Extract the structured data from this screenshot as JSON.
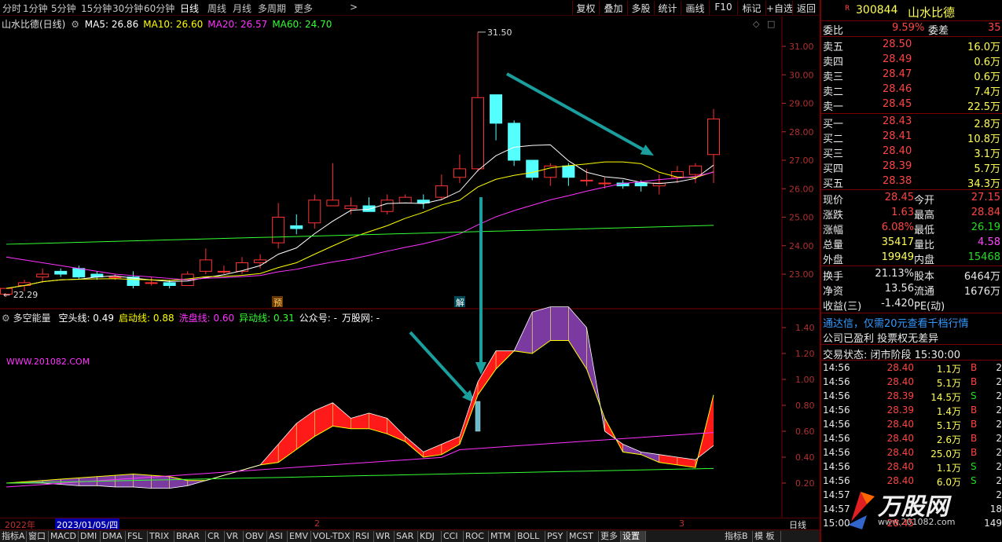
{
  "toolbar": {
    "periods": [
      "分时",
      "1分钟",
      "5分钟",
      "15分钟",
      "30分钟",
      "60分钟",
      "日线",
      "周线",
      "月线",
      "多周期",
      "更多"
    ],
    "active_period": "日线",
    "buttons": [
      "复权",
      "叠加",
      "多股",
      "统计",
      "画线",
      "F10",
      "标记",
      "+自选",
      "返回"
    ]
  },
  "main_chart": {
    "stock_label": "山水比德(日线)",
    "ma_legend": [
      {
        "label": "MA5: 26.86",
        "color": "#ffffff"
      },
      {
        "label": "MA10: 26.60",
        "color": "#ffff00"
      },
      {
        "label": "MA20: 26.57",
        "color": "#ff33ff"
      },
      {
        "label": "MA60: 24.70",
        "color": "#33ff33"
      }
    ],
    "high_label": "31.50",
    "low_label": "22.29",
    "y_ticks": [
      "31.00",
      "30.00",
      "29.00",
      "28.00",
      "27.00",
      "26.00",
      "25.00",
      "24.00",
      "23.00"
    ],
    "markers": [
      "预",
      "解"
    ]
  },
  "candles": [
    [
      22.3,
      22.5,
      22.2,
      22.5
    ],
    [
      22.6,
      22.8,
      22.4,
      22.7
    ],
    [
      22.9,
      23.2,
      22.7,
      23.0
    ],
    [
      23.1,
      23.2,
      22.9,
      23.0
    ],
    [
      23.2,
      23.3,
      22.8,
      22.9
    ],
    [
      23.0,
      23.1,
      22.8,
      22.9
    ],
    [
      22.9,
      23.0,
      22.8,
      22.9
    ],
    [
      22.9,
      23.1,
      22.5,
      22.6
    ],
    [
      22.7,
      22.9,
      22.6,
      22.7
    ],
    [
      22.7,
      22.8,
      22.5,
      22.6
    ],
    [
      22.6,
      23.1,
      22.6,
      23.0
    ],
    [
      23.1,
      23.9,
      23.0,
      23.5
    ],
    [
      23.1,
      23.3,
      23.0,
      23.1
    ],
    [
      23.1,
      23.6,
      23.0,
      23.4
    ],
    [
      23.4,
      23.7,
      23.2,
      23.5
    ],
    [
      24.1,
      25.5,
      23.9,
      25.0
    ],
    [
      24.7,
      25.1,
      24.4,
      24.6
    ],
    [
      24.8,
      25.8,
      24.6,
      25.6
    ],
    [
      25.4,
      26.9,
      25.4,
      25.6
    ],
    [
      25.3,
      25.7,
      25.1,
      25.4
    ],
    [
      25.4,
      25.7,
      25.2,
      25.2
    ],
    [
      25.2,
      25.8,
      25.1,
      25.6
    ],
    [
      25.5,
      25.8,
      25.6,
      25.7
    ],
    [
      25.6,
      25.8,
      25.3,
      25.5
    ],
    [
      25.7,
      26.5,
      25.6,
      26.1
    ],
    [
      26.4,
      27.2,
      26.2,
      26.7
    ],
    [
      26.7,
      31.5,
      26.6,
      29.2
    ],
    [
      29.3,
      29.3,
      27.7,
      28.3
    ],
    [
      28.3,
      28.4,
      26.8,
      27.0
    ],
    [
      27.0,
      27.0,
      26.3,
      26.4
    ],
    [
      26.4,
      26.9,
      26.1,
      26.8
    ],
    [
      26.8,
      26.9,
      26.1,
      26.4
    ],
    [
      26.3,
      26.7,
      26.1,
      26.3
    ],
    [
      26.2,
      26.4,
      26.0,
      26.2
    ],
    [
      26.2,
      26.3,
      26.0,
      26.1
    ],
    [
      26.2,
      26.3,
      25.9,
      26.1
    ],
    [
      26.1,
      26.5,
      25.8,
      26.2
    ],
    [
      26.4,
      26.8,
      26.2,
      26.6
    ],
    [
      26.5,
      26.9,
      26.2,
      26.8
    ],
    [
      27.2,
      28.8,
      26.2,
      28.45
    ]
  ],
  "sub_chart": {
    "title": "多空能量",
    "legend": [
      {
        "label": "空头线: 0.49",
        "color": "#ffffff"
      },
      {
        "label": "启动线: 0.88",
        "color": "#ffff00"
      },
      {
        "label": "洗盘线: 0.60",
        "color": "#ff33ff"
      },
      {
        "label": "异动线: 0.31",
        "color": "#33ff33"
      },
      {
        "label": "公众号: -",
        "color": "#ffffff"
      },
      {
        "label": "万股网: -",
        "color": "#ffffff"
      }
    ],
    "watermark": "WWW.201082.COM",
    "y_ticks": [
      "1.40",
      "1.20",
      "1.00",
      "0.80",
      "0.60",
      "0.40",
      "0.20"
    ]
  },
  "dates": [
    "2022年",
    "2023/01/05/四",
    "2",
    "3"
  ],
  "bottom_tabs": [
    "指标A",
    "窗口",
    "MACD",
    "DMI",
    "DMA",
    "FSL",
    "TRIX",
    "BRAR",
    "CR",
    "VR",
    "OBV",
    "ASI",
    "EMV",
    "VOL-TDX",
    "RSI",
    "WR",
    "SAR",
    "KDJ",
    "CCI",
    "ROC",
    "MTM",
    "BOLL",
    "PSY",
    "MCST",
    "更多",
    "设置"
  ],
  "bottom_right": [
    "指标B",
    "模 板"
  ],
  "period_side": "日线",
  "quote": {
    "code": "300844",
    "name": "山水比德",
    "weibi_label": "委比",
    "weibi": "9.59%",
    "weicha_label": "委差",
    "weicha": "35",
    "sell": [
      {
        "label": "卖五",
        "price": "28.50",
        "vol": "16.0万"
      },
      {
        "label": "卖四",
        "price": "28.49",
        "vol": "0.6万"
      },
      {
        "label": "卖三",
        "price": "28.47",
        "vol": "0.6万"
      },
      {
        "label": "卖二",
        "price": "28.46",
        "vol": "7.4万"
      },
      {
        "label": "卖一",
        "price": "28.45",
        "vol": "22.5万"
      }
    ],
    "buy": [
      {
        "label": "买一",
        "price": "28.43",
        "vol": "2.8万"
      },
      {
        "label": "买二",
        "price": "28.41",
        "vol": "10.8万"
      },
      {
        "label": "买三",
        "price": "28.40",
        "vol": "3.1万"
      },
      {
        "label": "买四",
        "price": "28.39",
        "vol": "5.7万"
      },
      {
        "label": "买五",
        "price": "28.38",
        "vol": "34.3万"
      }
    ],
    "stats": [
      {
        "l1": "现价",
        "v1": "28.45",
        "l2": "今开",
        "v2": "27.15"
      },
      {
        "l1": "涨跌",
        "v1": "1.63",
        "l2": "最高",
        "v2": "28.84"
      },
      {
        "l1": "涨幅",
        "v1": "6.08%",
        "l2": "最低",
        "v2": "26.19"
      },
      {
        "l1": "总量",
        "v1": "35417",
        "l2": "量比",
        "v2": "4.58"
      },
      {
        "l1": "外盘",
        "v1": "19949",
        "l2": "内盘",
        "v2": "15468"
      }
    ],
    "finance": [
      {
        "l1": "换手",
        "v1": "21.13%",
        "l2": "股本",
        "v2": "6464万"
      },
      {
        "l1": "净资",
        "v1": "13.56",
        "l2": "流通",
        "v2": "1676万"
      },
      {
        "l1": "收益(三)",
        "v1": "-1.420",
        "l2": "PE(动)",
        "v2": ""
      }
    ],
    "ad1": "通达信，仅需20元查看千档行情",
    "ad2": "公司已盈利 投票权无差异",
    "trade_status": "交易状态: 闭市阶段 15:30:00",
    "ticks": [
      {
        "time": "14:56",
        "price": "28.40",
        "vol": "1.1万",
        "side": "B"
      },
      {
        "time": "14:56",
        "price": "28.40",
        "vol": "5.1万",
        "side": "B"
      },
      {
        "time": "14:56",
        "price": "28.39",
        "vol": "14.5万",
        "side": "S"
      },
      {
        "time": "14:56",
        "price": "28.39",
        "vol": "1.4万",
        "side": "B"
      },
      {
        "time": "14:56",
        "price": "28.40",
        "vol": "5.1万",
        "side": "B"
      },
      {
        "time": "14:56",
        "price": "28.40",
        "vol": "2.6万",
        "side": "B"
      },
      {
        "time": "14:56",
        "price": "28.40",
        "vol": "25.0万",
        "side": "B"
      },
      {
        "time": "14:56",
        "price": "28.40",
        "vol": "1.1万",
        "side": "S"
      },
      {
        "time": "14:56",
        "price": "28.40",
        "vol": "6.0万",
        "side": "S"
      },
      {
        "time": "14:57",
        "price": "",
        "vol": "",
        "side": ""
      },
      {
        "time": "14:57",
        "price": "",
        "vol": "",
        "side": ""
      },
      {
        "time": "15:00",
        "price": "28.45",
        "vol": "",
        "side": ""
      }
    ],
    "right_edge_nums": [
      "2",
      "2",
      "2",
      "2",
      "2",
      "2",
      "2",
      "2",
      "2",
      "2",
      "18",
      "149"
    ],
    "logo_text": "万股网",
    "logo_url_text": "www.201082.com"
  }
}
